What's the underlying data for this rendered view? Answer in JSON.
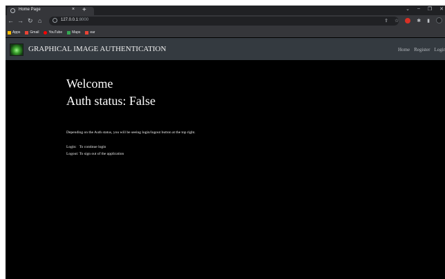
{
  "browser": {
    "tab_title": "Home Page",
    "tab_close": "×",
    "new_tab": "+",
    "url_host": "127.0.0.1",
    "url_port": ":8000",
    "bookmarks": [
      {
        "label": "Apps",
        "icon": "apps-grid-icon",
        "color": "#fbbc04"
      },
      {
        "label": "Gmail",
        "icon": "gmail-icon",
        "color": "#ea4335"
      },
      {
        "label": "YouTube",
        "icon": "youtube-icon",
        "color": "#ff0000"
      },
      {
        "label": "Maps",
        "icon": "maps-icon",
        "color": "#34a853"
      },
      {
        "label": "ear",
        "icon": "gmail-icon",
        "color": "#ea4335"
      }
    ]
  },
  "site": {
    "brand": "GRAPHICAL IMAGE AUTHENTICATION",
    "nav": [
      "Home",
      "Register",
      "Login"
    ]
  },
  "content": {
    "welcome": "Welcome",
    "auth_status": "Auth status: False",
    "description": "Depending on the Auth status, you will be seeing login/logout button at the top right.",
    "login_line": "Login:   To continue login",
    "logout_line": "Logout: To sign out of the application"
  }
}
